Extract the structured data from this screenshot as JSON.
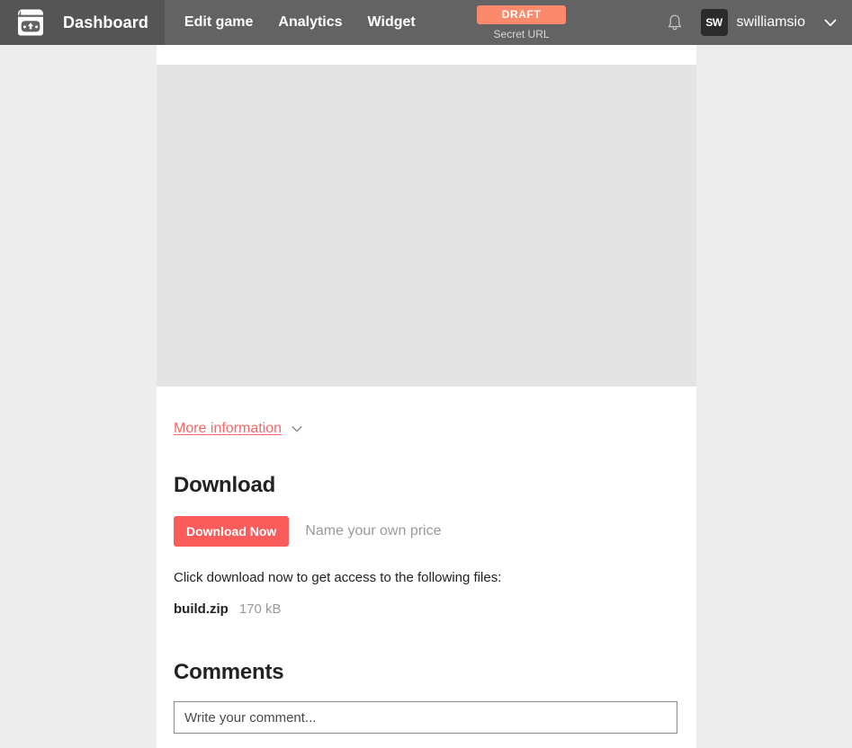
{
  "topbar": {
    "logo_icon": "itchio-logo-icon",
    "dashboard_label": "Dashboard",
    "nav": [
      {
        "label": "Edit game",
        "name": "nav-item-edit-game"
      },
      {
        "label": "Analytics",
        "name": "nav-item-analytics"
      },
      {
        "label": "Widget",
        "name": "nav-item-widget"
      }
    ],
    "status": {
      "badge_label": "DRAFT",
      "badge_color": "#fa8a6b",
      "secret_url_label": "Secret URL"
    },
    "notifications_icon": "bell-icon",
    "avatar_initials": "SW",
    "username": "swilliamsio",
    "user_menu_icon": "chevron-down-icon",
    "bar_color": "#636363",
    "bar_left_color": "#555555"
  },
  "page": {
    "background_color": "#ededed",
    "content_background_color": "#ffffff",
    "media_placeholder_color": "#e4e4e4"
  },
  "more_information": {
    "label": "More information",
    "link_color": "#fa6666",
    "toggle_icon": "chevron-down-icon"
  },
  "download": {
    "title": "Download",
    "button_label": "Download Now",
    "button_color": "#fa5c5c",
    "price_note": "Name your own price",
    "hint": "Click download now to get access to the following files:",
    "files": [
      {
        "name": "build.zip",
        "size": "170 kB"
      }
    ]
  },
  "comments": {
    "title": "Comments",
    "input_placeholder": "Write your comment..."
  }
}
